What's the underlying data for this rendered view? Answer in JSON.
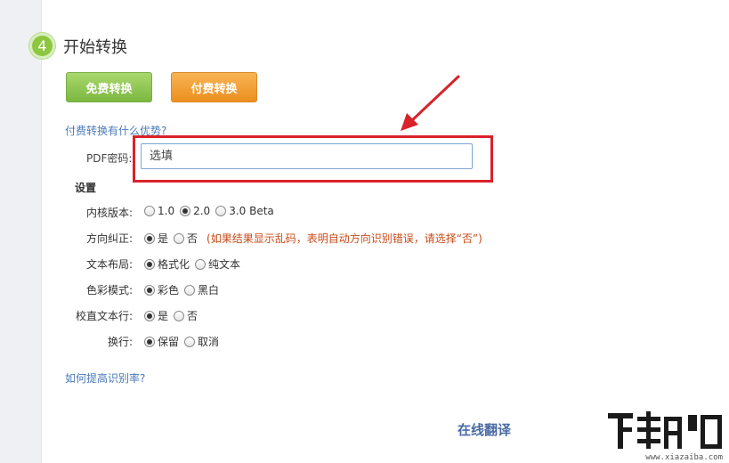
{
  "step": {
    "number": "4",
    "title": "开始转换"
  },
  "buttons": {
    "free": "免费转换",
    "paid": "付费转换"
  },
  "links": {
    "paid_advantage": "付费转换有什么优势?",
    "improve_rate": "如何提高识别率?",
    "translate": "在线翻译"
  },
  "password": {
    "label": "PDF密码:",
    "placeholder": "选填"
  },
  "settings": {
    "title": "设置",
    "rows": [
      {
        "label": "内核版本:",
        "options": [
          "1.0",
          "2.0",
          "3.0 Beta"
        ],
        "selected": 1
      },
      {
        "label": "方向纠正:",
        "options": [
          "是",
          "否"
        ],
        "selected": 0,
        "hint": "(如果结果显示乱码，表明自动方向识别错误，请选择“否”)"
      },
      {
        "label": "文本布局:",
        "options": [
          "格式化",
          "纯文本"
        ],
        "selected": 0
      },
      {
        "label": "色彩模式:",
        "options": [
          "彩色",
          "黑白"
        ],
        "selected": 0
      },
      {
        "label": "校直文本行:",
        "options": [
          "是",
          "否"
        ],
        "selected": 0
      },
      {
        "label": "换行:",
        "options": [
          "保留",
          "取消"
        ],
        "selected": 0
      }
    ]
  },
  "watermark": {
    "url": "www.xiazaiba.com"
  },
  "colors": {
    "highlight": "#d9222a",
    "free_button": "#8dc63f",
    "paid_button": "#f09a2c",
    "link": "#4a7ab8"
  }
}
